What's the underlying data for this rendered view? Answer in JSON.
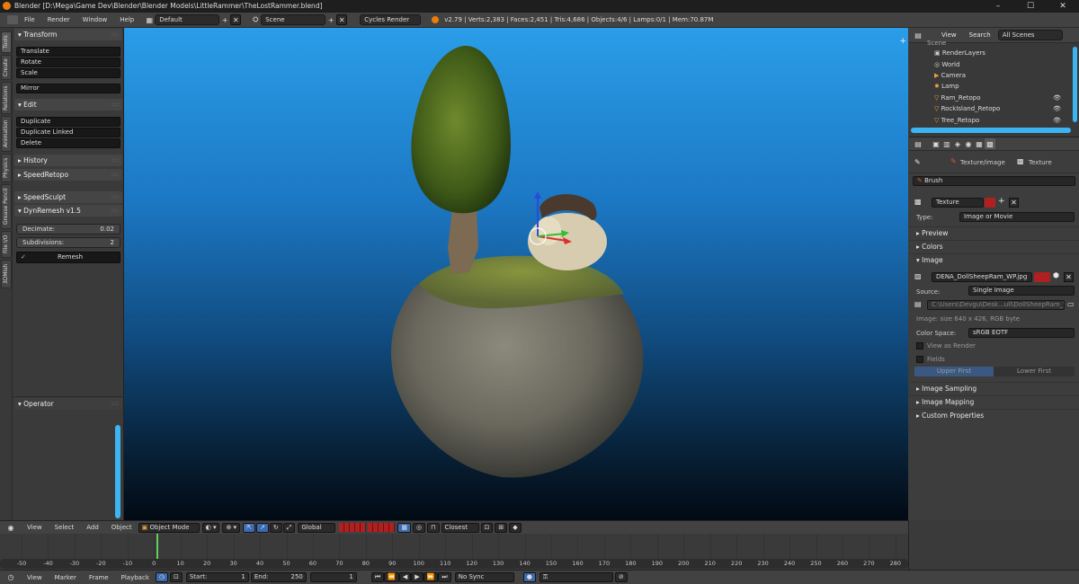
{
  "window": {
    "title": "Blender [D:\\Mega\\Game Dev\\Blender\\Blender Models\\LittleRammer\\TheLostRammer.blend]"
  },
  "infobar": {
    "menus": [
      "File",
      "Render",
      "Window",
      "Help"
    ],
    "layout": "Default",
    "scene": "Scene",
    "engine": "Cycles Render",
    "stats": "v2.79 | Verts:2,383 | Faces:2,451 | Tris:4,686 | Objects:4/6 | Lamps:0/1 | Mem:70.87M"
  },
  "tabs": [
    "Tools",
    "Create",
    "Relations",
    "Animation",
    "Physics",
    "Grease Pencil",
    "File I/O",
    "3DMish"
  ],
  "toolshelf": {
    "transform_title": "Transform",
    "translate": "Translate",
    "rotate": "Rotate",
    "scale": "Scale",
    "mirror": "Mirror",
    "edit_title": "Edit",
    "duplicate": "Duplicate",
    "duplicate_linked": "Duplicate Linked",
    "delete": "Delete",
    "history": "History",
    "speedretopo": "SpeedRetopo",
    "speedsculpt": "SpeedSculpt",
    "dynremesh": "DynRemesh v1.5",
    "decimate_label": "Decimate:",
    "decimate_value": "0.02",
    "subdivisions_label": "Subdivisions:",
    "subdivisions_value": "2",
    "remesh": "Remesh",
    "operator": "Operator"
  },
  "outliner": {
    "view": "View",
    "search": "Search",
    "filter": "All Scenes",
    "items": [
      {
        "label": "Scene"
      },
      {
        "label": "RenderLayers"
      },
      {
        "label": "World"
      },
      {
        "label": "Camera"
      },
      {
        "label": "Lamp"
      },
      {
        "label": "Ram_Retopo"
      },
      {
        "label": "RockIsland_Retopo"
      },
      {
        "label": "Tree_Retopo"
      }
    ]
  },
  "properties": {
    "tab_texture_image": "Texture/image",
    "tab_texture": "Texture",
    "brush": "Brush",
    "texture_name": "Texture",
    "type_label": "Type:",
    "type_value": "Image or Movie",
    "preview": "Preview",
    "colors": "Colors",
    "image": "Image",
    "image_name": "DENA_DollSheepRam_WP.jpg",
    "source_label": "Source:",
    "source_value": "Single Image",
    "filepath": "C:\\Users\\Devgu\\Desk...ull\\DollSheepRam_WP.jpg",
    "image_info": "Image: size 640 x 426, RGB byte",
    "color_space_label": "Color Space:",
    "color_space_value": "sRGB EOTF",
    "view_as_render": "View as Render",
    "fields": "Fields",
    "upper_first": "Upper First",
    "lower_first": "Lower First",
    "image_sampling": "Image Sampling",
    "image_mapping": "Image Mapping",
    "custom_properties": "Custom Properties"
  },
  "viewport_header": {
    "view": "View",
    "select": "Select",
    "add": "Add",
    "object": "Object",
    "mode": "Object Mode",
    "orientation": "Global",
    "snap": "Closest"
  },
  "timeline": {
    "ticks": [
      "-50",
      "-40",
      "-30",
      "-20",
      "-10",
      "0",
      "10",
      "20",
      "30",
      "40",
      "50",
      "60",
      "70",
      "80",
      "90",
      "100",
      "110",
      "120",
      "130",
      "140",
      "150",
      "160",
      "170",
      "180",
      "190",
      "200",
      "210",
      "220",
      "230",
      "240",
      "250",
      "260",
      "270",
      "280"
    ],
    "current_frame": 1,
    "view": "View",
    "marker": "Marker",
    "frame": "Frame",
    "playback": "Playback",
    "start_label": "Start:",
    "start_value": "1",
    "end_label": "End:",
    "end_value": "250",
    "frame_value": "1",
    "sync": "No Sync"
  },
  "colors": {
    "accent": "#3db4f2",
    "keyframe_red": "#b02020",
    "sky_top": "#2a9de8"
  }
}
